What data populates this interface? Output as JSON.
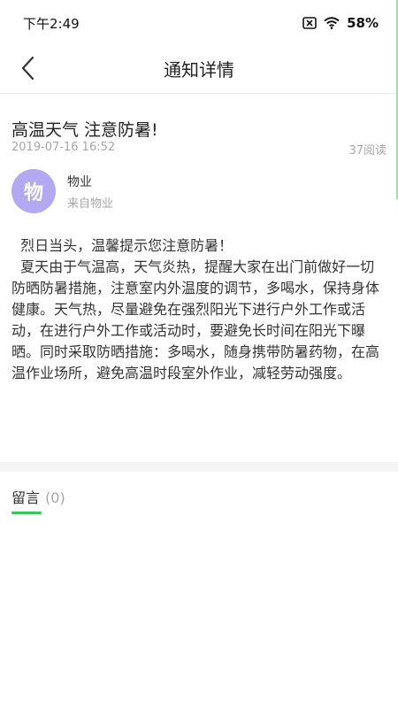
{
  "status_bar": {
    "time": "下午2:49",
    "battery": "58%",
    "icons": [
      "notification-off-icon",
      "wifi-icon"
    ]
  },
  "header": {
    "title": "通知详情",
    "back_icon": "chevron-left-icon"
  },
  "article": {
    "title": "高温天气 注意防暑!",
    "date": "2019-07-16 16:52",
    "read_count": "37阅读",
    "publisher": {
      "avatar_text": "物",
      "name": "物业",
      "source": "来自物业",
      "avatar_color": "#b3a9f2"
    },
    "paragraphs": [
      "  烈日当头，温馨提示您注意防暑！",
      "  夏天由于气温高，天气炎热，提醒大家在出门前做好一切防晒防暑措施，注意室内外温度的调节，多喝水，保持身体健康。天气热，尽量避免在强烈阳光下进行户外工作或活动，在进行户外工作或活动时，要避免长时间在阳光下曝晒。同时采取防晒措施：多喝水，随身携带防暑药物，在高温作业场所，避免高温时段室外作业，减轻劳动强度。"
    ]
  },
  "comments": {
    "label": "留言",
    "count": "(0)",
    "accent_color": "#3cc35a"
  }
}
